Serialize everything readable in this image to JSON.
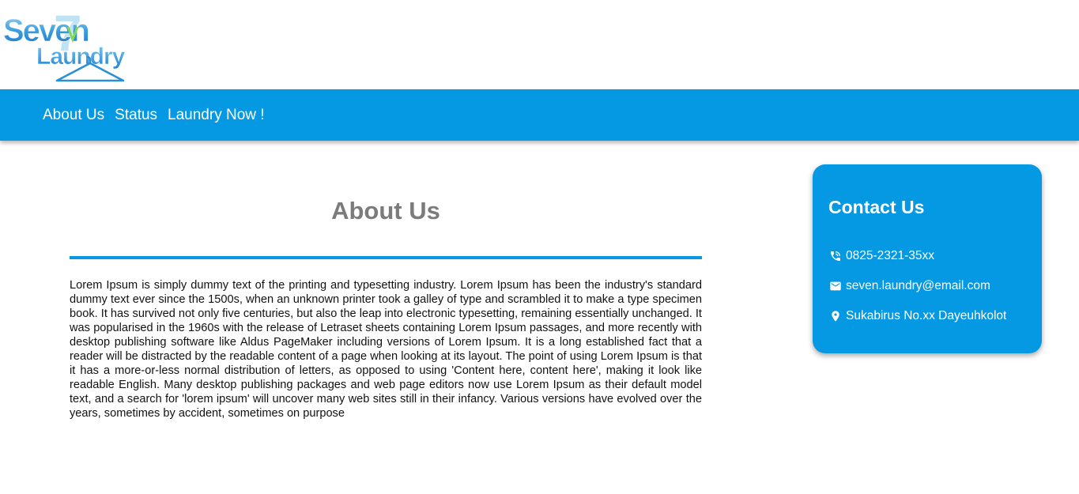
{
  "brand": {
    "logo_word1": "Seven",
    "logo_word2": "Laundry",
    "logo_numeral": "7",
    "colors": {
      "primary": "#0499e2",
      "logo_blue": "#2a8fd6",
      "logo_green": "#7ed957"
    }
  },
  "nav": {
    "items": [
      {
        "label": "About Us"
      },
      {
        "label": "Status"
      },
      {
        "label": "Laundry Now !"
      }
    ]
  },
  "main": {
    "title": "About Us",
    "body": "Lorem Ipsum is simply dummy text of the printing and typesetting industry. Lorem Ipsum has been the industry's standard dummy text ever since the 1500s, when an unknown printer took a galley of type and scrambled it to make a type specimen book. It has survived not only five centuries, but also the leap into electronic typesetting, remaining essentially unchanged. It was popularised in the 1960s with the release of Letraset sheets containing Lorem Ipsum passages, and more recently with desktop publishing software like Aldus PageMaker including versions of Lorem Ipsum. It is a long established fact that a reader will be distracted by the readable content of a page when looking at its layout. The point of using Lorem Ipsum is that it has a more-or-less normal distribution of letters, as opposed to using 'Content here, content here', making it look like readable English. Many desktop publishing packages and web page editors now use Lorem Ipsum as their default model text, and a search for 'lorem ipsum' will uncover many web sites still in their infancy. Various versions have evolved over the years, sometimes by accident, sometimes on purpose"
  },
  "contact": {
    "title": "Contact Us",
    "phone": {
      "icon": "phone-icon",
      "text": "0825-2321-35xx"
    },
    "email": {
      "icon": "mail-icon",
      "text": "seven.laundry@email.com"
    },
    "address": {
      "icon": "location-pin-icon",
      "text": "Sukabirus No.xx Dayeuhkolot"
    }
  }
}
